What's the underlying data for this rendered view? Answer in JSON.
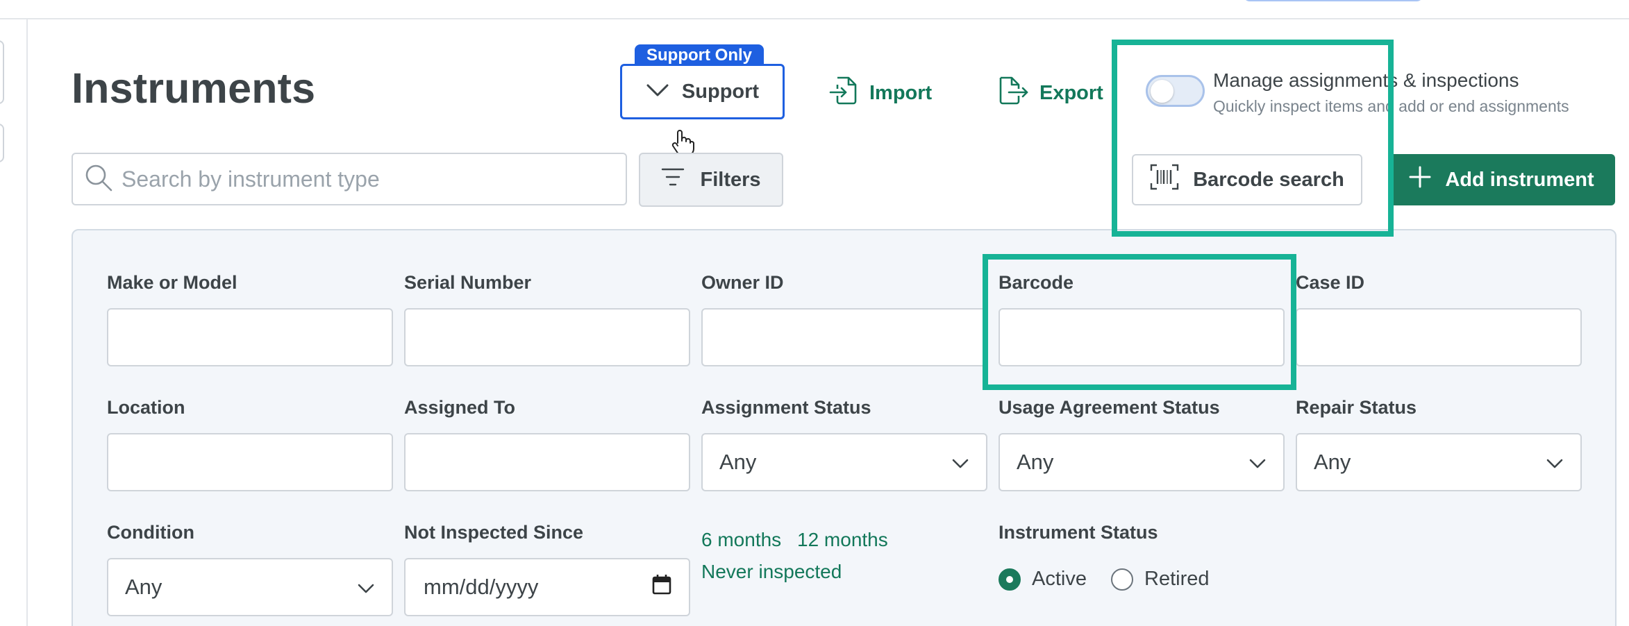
{
  "header": {
    "title": "Instruments",
    "support_tag": "Support Only",
    "support_label": "Support",
    "import_label": "Import",
    "export_label": "Export"
  },
  "manage": {
    "title": "Manage assignments & inspections",
    "subtitle": "Quickly inspect items and add or end assignments",
    "enabled": false
  },
  "search": {
    "placeholder": "Search by instrument type",
    "value": ""
  },
  "toolbar": {
    "filters_label": "Filters",
    "barcode_search_label": "Barcode search",
    "add_instrument_label": "Add instrument"
  },
  "filters": {
    "make_model": {
      "label": "Make or Model",
      "value": ""
    },
    "serial_number": {
      "label": "Serial Number",
      "value": ""
    },
    "owner_id": {
      "label": "Owner ID",
      "value": ""
    },
    "barcode": {
      "label": "Barcode",
      "value": ""
    },
    "case_id": {
      "label": "Case ID",
      "value": ""
    },
    "location": {
      "label": "Location",
      "value": ""
    },
    "assigned_to": {
      "label": "Assigned To",
      "value": ""
    },
    "assignment_status": {
      "label": "Assignment Status",
      "value": "Any"
    },
    "usage_agreement_status": {
      "label": "Usage Agreement Status",
      "value": "Any"
    },
    "repair_status": {
      "label": "Repair Status",
      "value": "Any"
    },
    "condition": {
      "label": "Condition",
      "value": "Any"
    },
    "not_inspected_since": {
      "label": "Not Inspected Since",
      "placeholder": "mm/dd/yyyy"
    },
    "quick_links": [
      "6 months",
      "12 months",
      "Never inspected"
    ],
    "instrument_status": {
      "label": "Instrument Status",
      "options": [
        "Active",
        "Retired"
      ],
      "selected": "Active"
    }
  },
  "colors": {
    "accent_green": "#1b7a5c",
    "link_green": "#13785a",
    "support_blue": "#1e5fe0",
    "highlight_teal": "#17b396"
  }
}
